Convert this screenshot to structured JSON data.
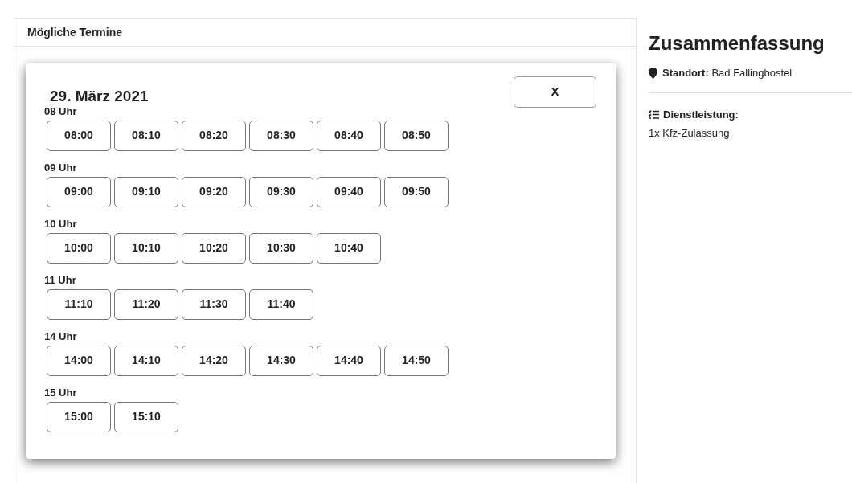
{
  "panel": {
    "title": "Mögliche Termine"
  },
  "dialog": {
    "date": "29. März 2021",
    "close_button": "X",
    "groups": [
      {
        "label": "08 Uhr",
        "slots": [
          "08:00",
          "08:10",
          "08:20",
          "08:30",
          "08:40",
          "08:50"
        ]
      },
      {
        "label": "09 Uhr",
        "slots": [
          "09:00",
          "09:10",
          "09:20",
          "09:30",
          "09:40",
          "09:50"
        ]
      },
      {
        "label": "10 Uhr",
        "slots": [
          "10:00",
          "10:10",
          "10:20",
          "10:30",
          "10:40"
        ]
      },
      {
        "label": "11 Uhr",
        "slots": [
          "11:10",
          "11:20",
          "11:30",
          "11:40"
        ]
      },
      {
        "label": "14 Uhr",
        "slots": [
          "14:00",
          "14:10",
          "14:20",
          "14:30",
          "14:40",
          "14:50"
        ]
      },
      {
        "label": "15 Uhr",
        "slots": [
          "15:00",
          "15:10"
        ]
      }
    ]
  },
  "summary": {
    "title": "Zusammenfassung",
    "location": "**Standort:** Bad Fallingbostel",
    "service_label": "Dienstleistung:",
    "service_value": "1x Kfz-Zulassung"
  }
}
